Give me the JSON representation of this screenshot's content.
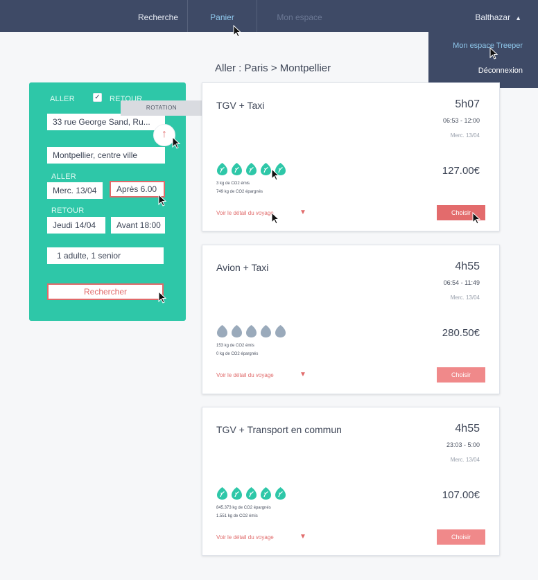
{
  "nav": {
    "recherche": "Recherche",
    "panier": "Panier",
    "espace": "Mon espace",
    "user": "Balthazar",
    "caret": "▲",
    "dropdown": {
      "espace_treeper": "Mon espace Treeper",
      "deconnexion": "Déconnexion"
    }
  },
  "route_title": "Aller : Paris > Montpellier",
  "search": {
    "aller_label": "ALLER",
    "retour_label": "RETOUR",
    "retour_checked": "✓",
    "from": "33 rue George Sand, Ru...",
    "to": "Montpellier, centre ville",
    "aller_section": "ALLER",
    "aller_date": "Merc. 13/04",
    "aller_time": "Après 6.00",
    "retour_section": "RETOUR",
    "retour_date": "Jeudi 14/04",
    "retour_time": "Avant 18:00",
    "passengers": "1 adulte, 1 senior",
    "search_button": "Rechercher",
    "tooltip": "ROTATION",
    "swap_icon": "↑"
  },
  "colors": {
    "nav_bg": "#3e4a66",
    "sidebar_bg": "#2ec7a8",
    "accent_red": "#e06a6a",
    "leaf_green": "#2ec7a8",
    "leaf_grey": "#9aaabb"
  },
  "results": [
    {
      "title": "TGV + Taxi",
      "duration": "5h07",
      "times": "06:53 - 12:00",
      "date": "Merc. 13/04",
      "leaves": 5,
      "leaf_color": "green",
      "co2_line1": "3 kg de CO2 émis",
      "co2_line2": "749 kg de CO2 épargnés",
      "price": "127.00€",
      "detail_link": "Voir le détail du voyage",
      "choose_button": "Choisir"
    },
    {
      "title": "Avion + Taxi",
      "duration": "4h55",
      "times": "06:54 - 11:49",
      "date": "Merc. 13/04",
      "leaves": 5,
      "leaf_color": "grey",
      "co2_line1": "153 kg de CO2 émis",
      "co2_line2": "0 kg de CO2 épargnés",
      "price": "280.50€",
      "detail_link": "Voir le détail du voyage",
      "choose_button": "Choisir"
    },
    {
      "title": "TGV + Transport en commun",
      "duration": "4h55",
      "times": "23:03 - 5:00",
      "date": "Merc. 13/04",
      "leaves": 5,
      "leaf_color": "green",
      "co2_line1": "845.373 kg de CO2 épargnés",
      "co2_line2": "1.551 kg de CO2 émis",
      "price": "107.00€",
      "detail_link": "Voir le détail du voyage",
      "choose_button": "Choisir"
    }
  ]
}
